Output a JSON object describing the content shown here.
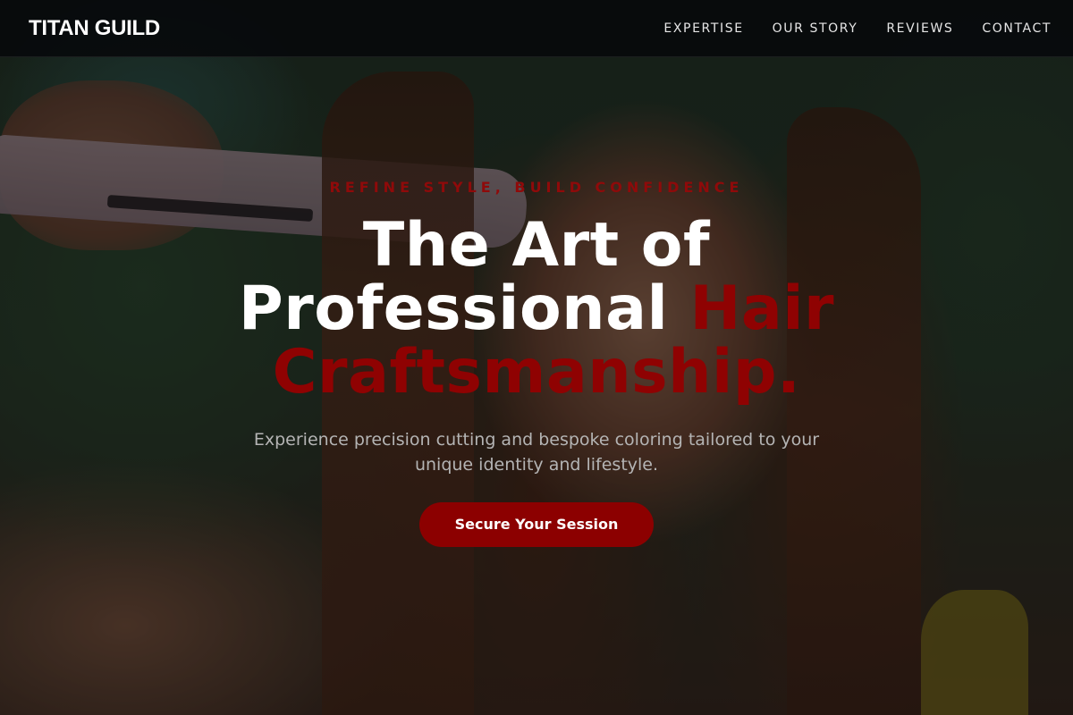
{
  "nav": {
    "brand": "TITAN GUILD",
    "links": [
      {
        "label": "EXPERTISE"
      },
      {
        "label": "OUR STORY"
      },
      {
        "label": "REVIEWS"
      },
      {
        "label": "CONTACT"
      }
    ]
  },
  "hero": {
    "eyebrow": "REFINE STYLE, BUILD CONFIDENCE",
    "headline_line1": "The Art of",
    "headline_line2_plain": "Professional",
    "headline_line2_accent": "Hair",
    "headline_line3_accent": "Craftsmanship.",
    "subtitle": "Experience precision cutting and bespoke coloring tailored to your unique identity and lifestyle.",
    "cta_label": "Secure Your Session"
  },
  "colors": {
    "accent": "#8c0000",
    "nav_background": "#0a0c0e",
    "headline": "#ffffff",
    "subtitle": "#b4b4b4"
  }
}
